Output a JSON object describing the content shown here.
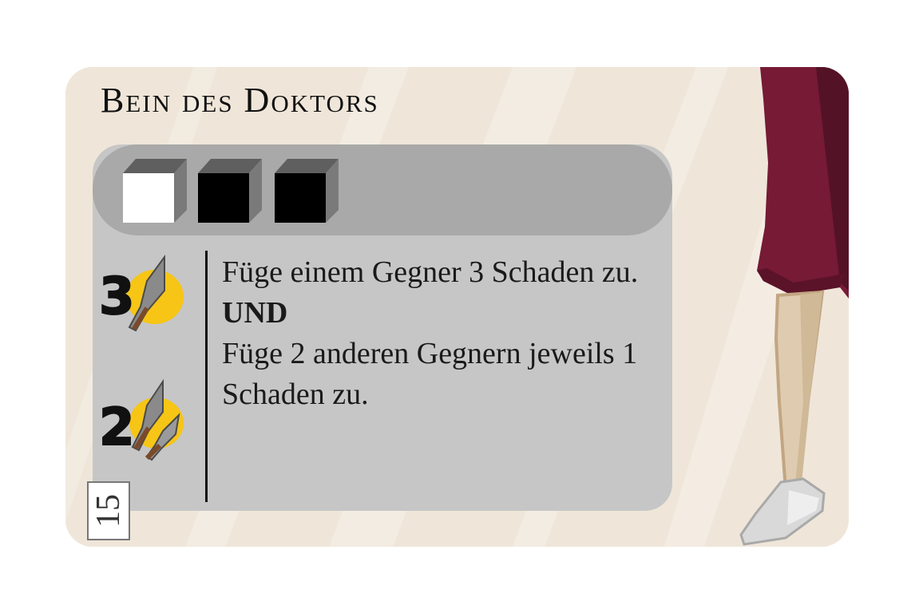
{
  "card": {
    "title": "Bein des Doktors",
    "cost": {
      "cubes": [
        {
          "icon": "cost-cube-icon",
          "face_color": "#ffffff"
        },
        {
          "icon": "cost-cube-icon",
          "face_color": "#000000"
        },
        {
          "icon": "cost-cube-icon",
          "face_color": "#000000"
        }
      ]
    },
    "effects": [
      {
        "icon": "one-dart-damage-icon",
        "amount": "3"
      },
      {
        "icon": "two-darts-damage-icon",
        "amount": "2"
      }
    ],
    "text": {
      "line1": "Füge einem Gegner 3 Schaden zu.",
      "connector": "UND",
      "line2": "Füge 2 anderen Gegnern jeweils 1 Schaden zu."
    },
    "number": "15",
    "illustration": "doctor-leg-icon",
    "colors": {
      "background": "#efe6d9",
      "panel": "#c6c6c6",
      "cost_bar": "#a9a9a9",
      "trousers": "#761a36",
      "skin": "#dfcbb0",
      "shoe": "#d9d9d9",
      "dart_badge": "#f6c516"
    }
  }
}
